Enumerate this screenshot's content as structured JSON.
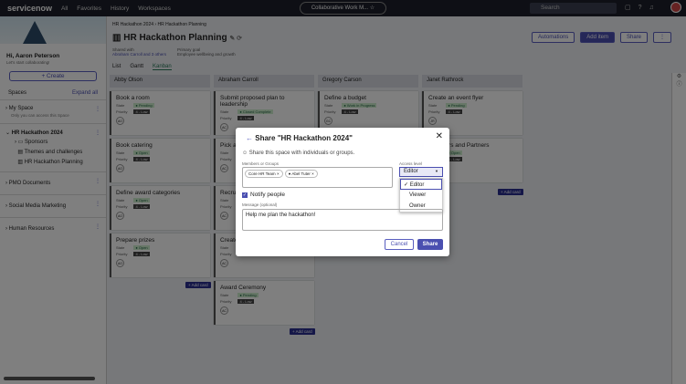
{
  "topbar": {
    "logo": "servicenow",
    "nav": [
      "All",
      "Favorites",
      "History",
      "Workspaces"
    ],
    "workspace": "Collaborative Work M...",
    "search_placeholder": "Search"
  },
  "sidebar": {
    "greeting": "Hi, Aaron Peterson",
    "subtitle": "Let's start collaborating!",
    "create": "+ Create",
    "spaces_label": "Spaces",
    "expand_all": "Expand all",
    "spaces": [
      {
        "label": "My Space",
        "desc": "Only you can access this Space"
      },
      {
        "label": "HR Hackathon 2024",
        "children": [
          "Sponsors",
          "Themes and challenges",
          "HR Hackathon Planning"
        ]
      },
      {
        "label": "PMO Documents"
      },
      {
        "label": "Social Media Marketing"
      },
      {
        "label": "Human Resources"
      }
    ]
  },
  "header": {
    "breadcrumb": [
      "HR Hackathon 2024",
      "HR Hackathon Planning"
    ],
    "title": "HR Hackathon Planning",
    "shared_label": "Shared with",
    "shared_value": "Abraham Carroll and 3 others",
    "goal_label": "Primary goal",
    "goal_value": "Employee wellbeing and growth",
    "automations": "Automations",
    "add_item": "Add item",
    "share": "Share",
    "tabs": [
      "List",
      "Gantt",
      "Kanban"
    ]
  },
  "board": {
    "state_label": "State",
    "priority_label": "Priority",
    "add_card": "+ Add card",
    "columns": [
      {
        "name": "Abby Olson",
        "cards": [
          {
            "title": "Book a room",
            "state": "Pending",
            "priority": "4 - Low",
            "initials": "AO"
          },
          {
            "title": "Book catering",
            "state": "Open",
            "priority": "4 - Low",
            "initials": "AO"
          },
          {
            "title": "Define award categories",
            "state": "Open",
            "priority": "4 - Low",
            "initials": "AO"
          },
          {
            "title": "Prepare prizes",
            "state": "Open",
            "priority": "4 - Low",
            "initials": "AO"
          }
        ]
      },
      {
        "name": "Abraham Carroll",
        "cards": [
          {
            "title": "Submit proposed plan to leadership",
            "state": "Closed Complete",
            "priority": "4 - Low",
            "initials": "AC"
          },
          {
            "title": "Pick a",
            "state": "",
            "priority": "",
            "initials": "AC"
          },
          {
            "title": "Recrui",
            "state": "",
            "priority": "",
            "initials": "AC"
          },
          {
            "title": "Create",
            "state": "",
            "priority": "",
            "initials": "AC"
          },
          {
            "title": "Award Ceremony",
            "state": "Pending",
            "priority": "4 - Low",
            "initials": "AC"
          }
        ]
      },
      {
        "name": "Gregory Carson",
        "cards": [
          {
            "title": "Define a budget",
            "state": "Work in Progress",
            "priority": "4 - Low",
            "initials": "GC"
          }
        ]
      },
      {
        "name": "Janet Rathrock",
        "cards": [
          {
            "title": "Create an event flyer",
            "state": "Pending",
            "priority": "4 - Low",
            "initials": "JR"
          },
          {
            "title": "Sponsors and Partners",
            "state": "Open",
            "priority": "4 - Low",
            "initials": ""
          }
        ]
      }
    ]
  },
  "dialog": {
    "title": "Share \"HR Hackathon 2024\"",
    "subtitle": "Share this space with individuals or groups.",
    "members_label": "Members or Groups",
    "members": [
      "Core HR Team",
      "Abel Tuter"
    ],
    "access_label": "Access level",
    "access_value": "Editor",
    "access_options": [
      "Editor",
      "Viewer",
      "Owner"
    ],
    "notify": "Notify people",
    "message_label": "Message (optional)",
    "message": "Help me plan the hackathon!",
    "cancel": "Cancel",
    "share": "Share"
  }
}
